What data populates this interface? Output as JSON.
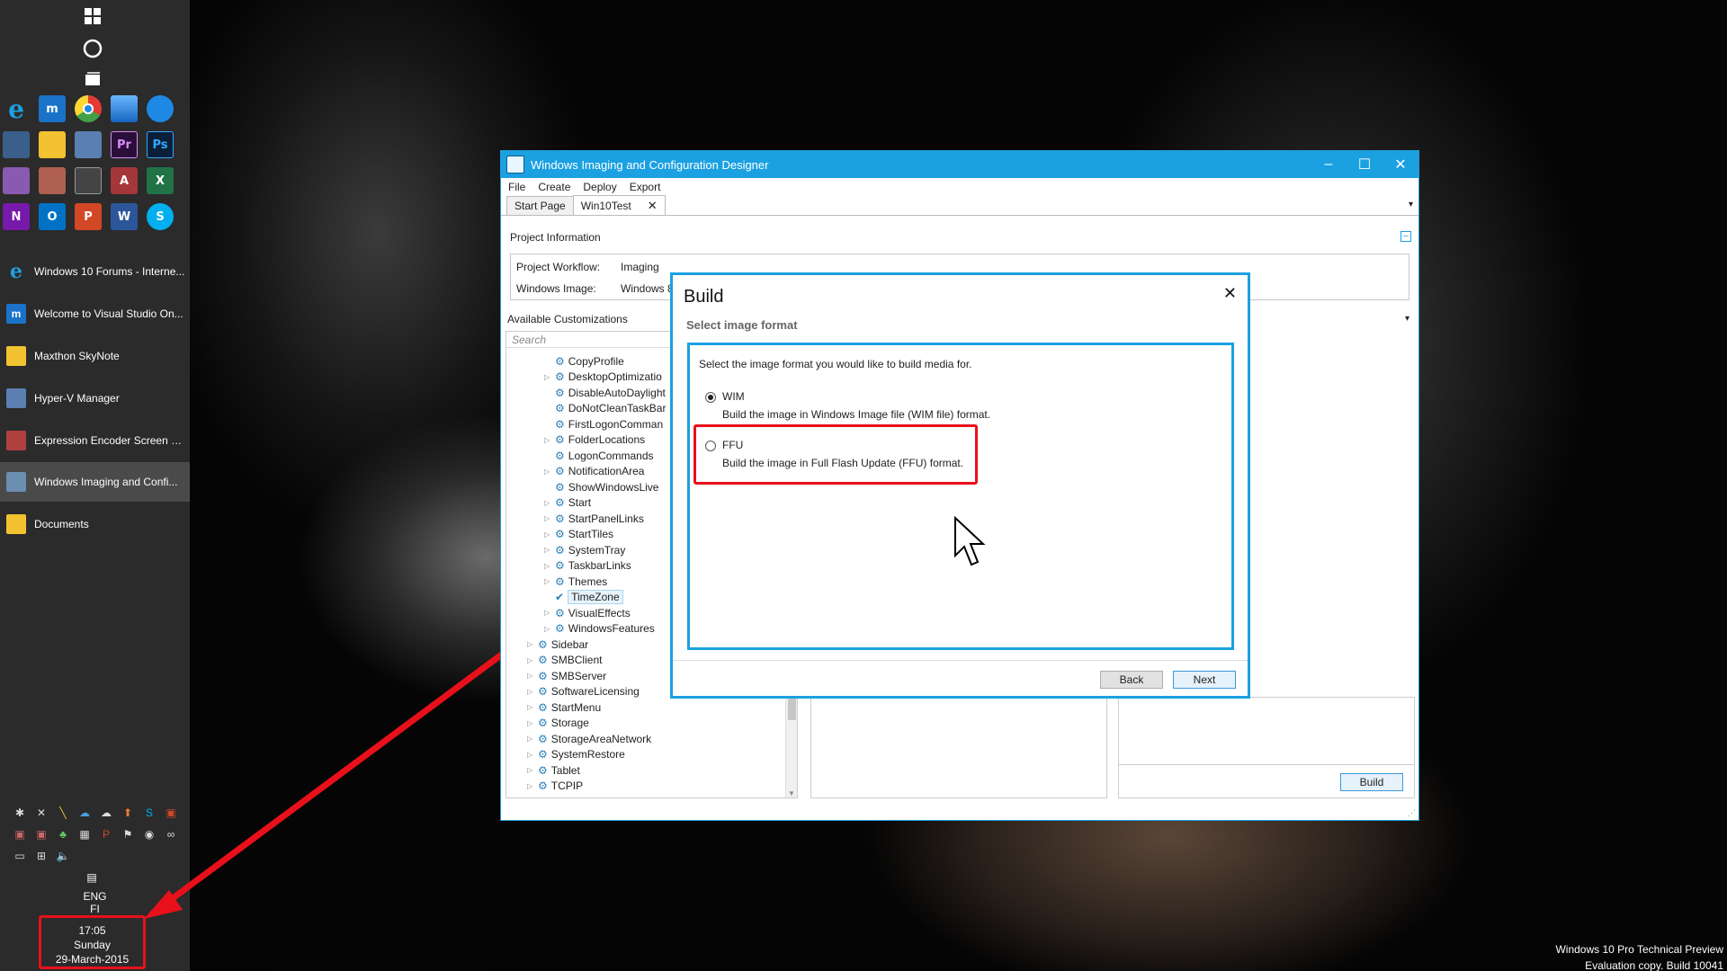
{
  "taskbar": {
    "items": [
      {
        "label": "Windows 10 Forums - Interne..."
      },
      {
        "label": "Welcome to Visual Studio On..."
      },
      {
        "label": "Maxthon SkyNote"
      },
      {
        "label": "Hyper-V Manager"
      },
      {
        "label": "Expression Encoder Screen Ca..."
      },
      {
        "label": "Windows Imaging and Confi..."
      },
      {
        "label": "Documents"
      }
    ],
    "lang": "ENG",
    "lang2": "FI",
    "time": "17:05",
    "day": "Sunday",
    "date": "29-March-2015",
    "pinned_labels": [
      "e",
      "m",
      "",
      "",
      "",
      "",
      "",
      "",
      "Pr",
      "Ps",
      "",
      "",
      "",
      "A",
      "X",
      "N",
      "O",
      "P",
      "W",
      "S"
    ]
  },
  "window": {
    "title": "Windows Imaging and Configuration Designer",
    "menu": [
      "File",
      "Create",
      "Deploy",
      "Export"
    ],
    "tabs": [
      {
        "label": "Start Page"
      },
      {
        "label": "Win10Test"
      }
    ],
    "project_info_title": "Project Information",
    "workflow_label": "Project Workflow:",
    "workflow_value": "Imaging",
    "image_label": "Windows Image:",
    "image_value": "Windows 8",
    "available_title": "Available Customizations",
    "search_placeholder": "Search",
    "tree": [
      {
        "label": "CopyProfile",
        "level": 2,
        "exp": false
      },
      {
        "label": "DesktopOptimizatio",
        "level": 2,
        "exp": true
      },
      {
        "label": "DisableAutoDaylight",
        "level": 2,
        "exp": false
      },
      {
        "label": "DoNotCleanTaskBar",
        "level": 2,
        "exp": false
      },
      {
        "label": "FirstLogonComman",
        "level": 2,
        "exp": false
      },
      {
        "label": "FolderLocations",
        "level": 2,
        "exp": true
      },
      {
        "label": "LogonCommands",
        "level": 2,
        "exp": false
      },
      {
        "label": "NotificationArea",
        "level": 2,
        "exp": true
      },
      {
        "label": "ShowWindowsLive",
        "level": 2,
        "exp": false
      },
      {
        "label": "Start",
        "level": 2,
        "exp": true
      },
      {
        "label": "StartPanelLinks",
        "level": 2,
        "exp": true
      },
      {
        "label": "StartTiles",
        "level": 2,
        "exp": true
      },
      {
        "label": "SystemTray",
        "level": 2,
        "exp": true
      },
      {
        "label": "TaskbarLinks",
        "level": 2,
        "exp": true
      },
      {
        "label": "Themes",
        "level": 2,
        "exp": true
      },
      {
        "label": "TimeZone",
        "level": 2,
        "exp": false,
        "selected": true
      },
      {
        "label": "VisualEffects",
        "level": 2,
        "exp": true
      },
      {
        "label": "WindowsFeatures",
        "level": 2,
        "exp": true
      },
      {
        "label": "Sidebar",
        "level": 1,
        "exp": true
      },
      {
        "label": "SMBClient",
        "level": 1,
        "exp": true
      },
      {
        "label": "SMBServer",
        "level": 1,
        "exp": true
      },
      {
        "label": "SoftwareLicensing",
        "level": 1,
        "exp": true
      },
      {
        "label": "StartMenu",
        "level": 1,
        "exp": true
      },
      {
        "label": "Storage",
        "level": 1,
        "exp": true
      },
      {
        "label": "StorageAreaNetwork",
        "level": 1,
        "exp": true
      },
      {
        "label": "SystemRestore",
        "level": 1,
        "exp": true
      },
      {
        "label": "Tablet",
        "level": 1,
        "exp": true
      },
      {
        "label": "TCPIP",
        "level": 1,
        "exp": true
      }
    ],
    "build_button": "Build"
  },
  "dialog": {
    "title": "Build",
    "subtitle": "Select image format",
    "prompt": "Select the image format you would like to build media for.",
    "options": [
      {
        "label": "WIM",
        "desc": "Build the image in Windows Image file (WIM file) format.",
        "selected": true
      },
      {
        "label": "FFU",
        "desc": "Build the image in Full Flash Update (FFU) format.",
        "selected": false
      }
    ],
    "back_label": "Back",
    "next_label": "Next"
  },
  "watermark": {
    "line1": "Windows 10 Pro Technical Preview",
    "line2": "Evaluation copy. Build 10041"
  },
  "colors": {
    "accent": "#1ba1e2",
    "highlight": "#e8101a",
    "taskbar": "#2b2b2b"
  }
}
